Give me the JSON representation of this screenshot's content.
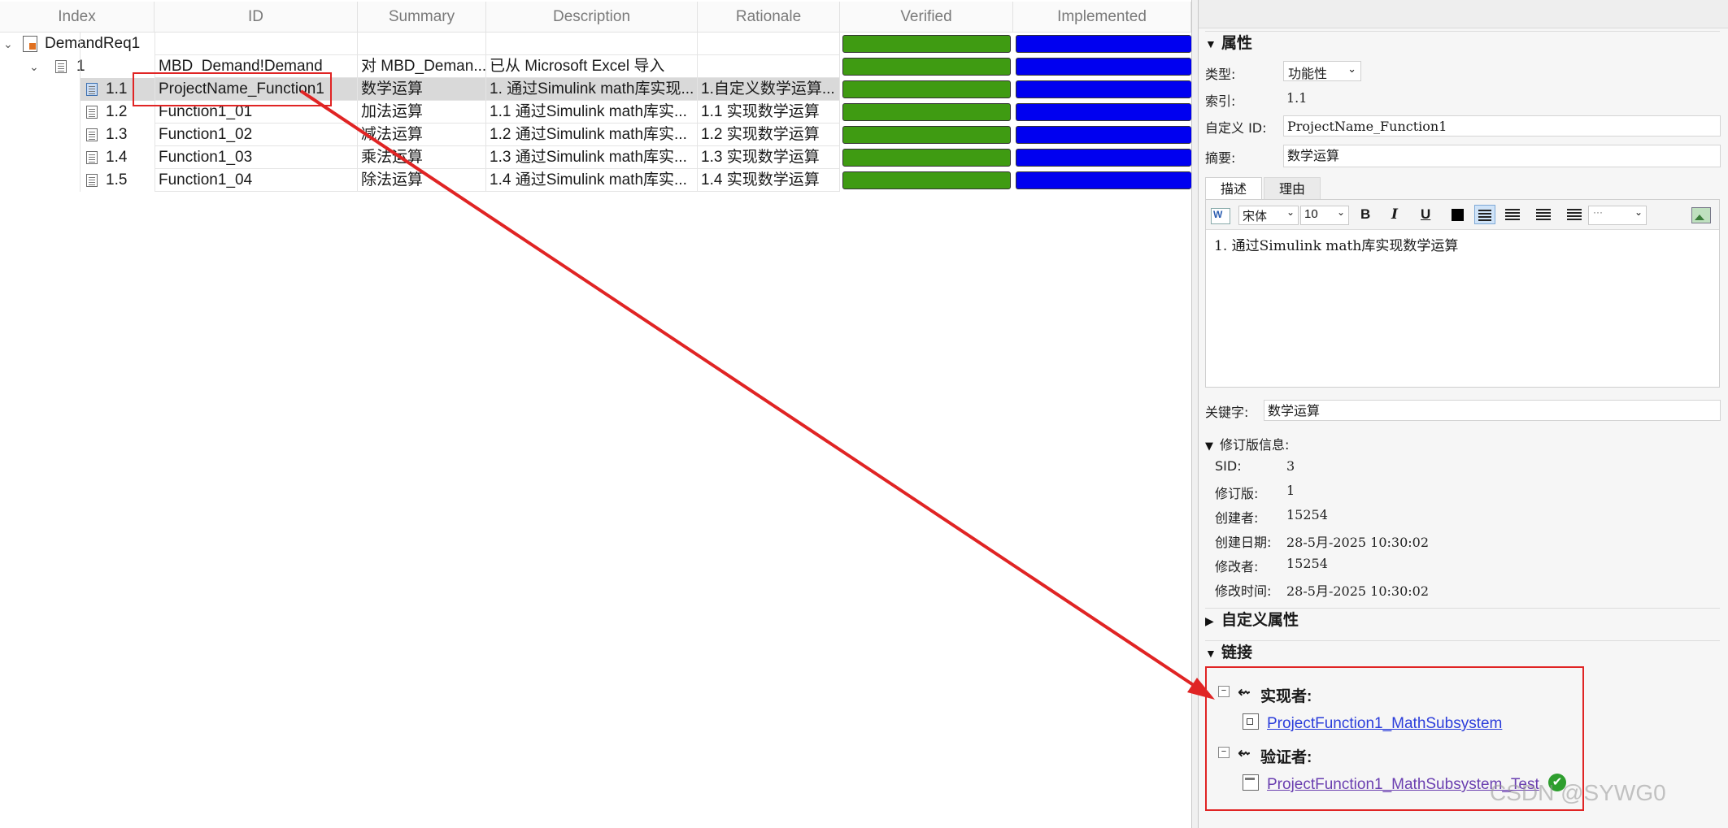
{
  "table": {
    "headers": [
      "Index",
      "ID",
      "Summary",
      "Description",
      "Rationale",
      "Verified",
      "Implemented"
    ],
    "root": {
      "index": "DemandReq1"
    },
    "group": {
      "index": "1",
      "id": "MBD_Demand!Demand",
      "summary": "对 MBD_Deman...",
      "description": "已从 Microsoft Excel 导入",
      "rationale": ""
    },
    "rows": [
      {
        "index": "1.1",
        "id": "ProjectName_Function1",
        "summary": "数学运算",
        "description": "1. 通过Simulink math库实现...",
        "rationale": "1.自定义数学运算...",
        "selected": true
      },
      {
        "index": "1.2",
        "id": "Function1_01",
        "summary": "加法运算",
        "description": "1.1 通过Simulink math库实...",
        "rationale": "1.1 实现数学运算"
      },
      {
        "index": "1.3",
        "id": "Function1_02",
        "summary": "减法运算",
        "description": "1.2 通过Simulink math库实...",
        "rationale": "1.2 实现数学运算"
      },
      {
        "index": "1.4",
        "id": "Function1_03",
        "summary": "乘法运算",
        "description": "1.3 通过Simulink math库实...",
        "rationale": "1.3 实现数学运算"
      },
      {
        "index": "1.5",
        "id": "Function1_04",
        "summary": "除法运算",
        "description": "1.4 通过Simulink math库实...",
        "rationale": "1.4 实现数学运算"
      }
    ],
    "verified_color": "#3f9b12",
    "implemented_color": "#0000f0"
  },
  "panel": {
    "properties_title": "属性",
    "type_label": "类型:",
    "type_value": "功能性",
    "index_label": "索引:",
    "index_value": "1.1",
    "custom_id_label": "自定义 ID:",
    "custom_id_value": "ProjectName_Function1",
    "summary_label": "摘要:",
    "summary_value": "数学运算",
    "tab_description": "描述",
    "tab_rationale": "理由",
    "font_name": "宋体",
    "font_size": "10",
    "description_text": "1. 通过Simulink math库实现数学运算",
    "keywords_label": "关键字:",
    "keywords_value": "数学运算",
    "revision_title": "修订版信息:",
    "sid_label": "SID:",
    "sid_value": "3",
    "revision_label": "修订版:",
    "revision_value": "1",
    "creator_label": "创建者:",
    "creator_value": "15254",
    "created_label": "创建日期:",
    "created_value": "28-5月-2025 10:30:02",
    "modifier_label": "修改者:",
    "modifier_value": "15254",
    "modified_label": "修改时间:",
    "modified_value": "28-5月-2025 10:30:02",
    "custom_attr_title": "自定义属性",
    "links_title": "链接",
    "implemented_by_label": "实现者:",
    "implemented_by_link": "ProjectFunction1_MathSubsystem",
    "verified_by_label": "验证者:",
    "verified_by_link": "ProjectFunction1_MathSubsystem_Test"
  },
  "watermark": "CSDN @SYWG0",
  "accent_red": "#e02424"
}
